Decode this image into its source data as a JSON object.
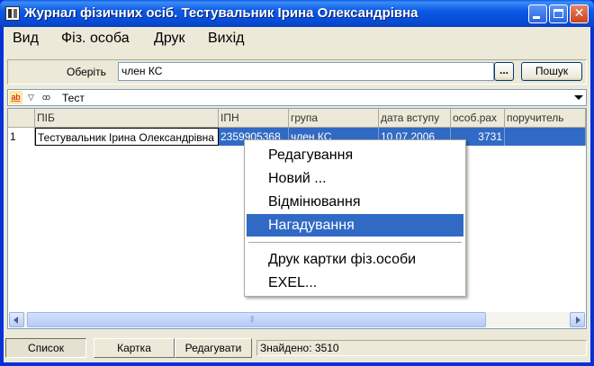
{
  "window": {
    "title": "Журнал фізичних осіб. Тестувальник Ірина Олександрівна"
  },
  "menu": [
    "Вид",
    "Фіз. особа",
    "Друк",
    "Вихід"
  ],
  "search": {
    "label": "Оберіть",
    "value": "член КС",
    "dots_label": "...",
    "search_button": "Пошук"
  },
  "filter": {
    "value": "Тест"
  },
  "grid": {
    "columns": [
      "ПІБ",
      "ІПН",
      "група",
      "дата вступу",
      "особ.рах",
      "поручитель"
    ],
    "rows": [
      {
        "num": "1",
        "pib": "Тестувальник Ірина Олександрівна",
        "ipn": "2359905368",
        "group": "член КС",
        "date": "10.07.2006",
        "account": "3731",
        "guarantor": ""
      }
    ]
  },
  "context_menu": {
    "items": [
      "Редагування",
      "Новий ...",
      "Відмінювання",
      "Нагадування",
      "Друк картки фіз.особи",
      "EXEL..."
    ],
    "selected_index": 3
  },
  "status": {
    "tabs": [
      "Список",
      "Картка",
      "Редагувати"
    ],
    "active_tab": 0,
    "found_text": "Знайдено: 3510"
  },
  "colors": {
    "selection": "#316ac5",
    "titlebar": "#0b5ae6"
  },
  "icons": {
    "filter_icons": [
      "sort-az-icon",
      "filter-funnel-icon",
      "glasses-search-icon"
    ]
  }
}
